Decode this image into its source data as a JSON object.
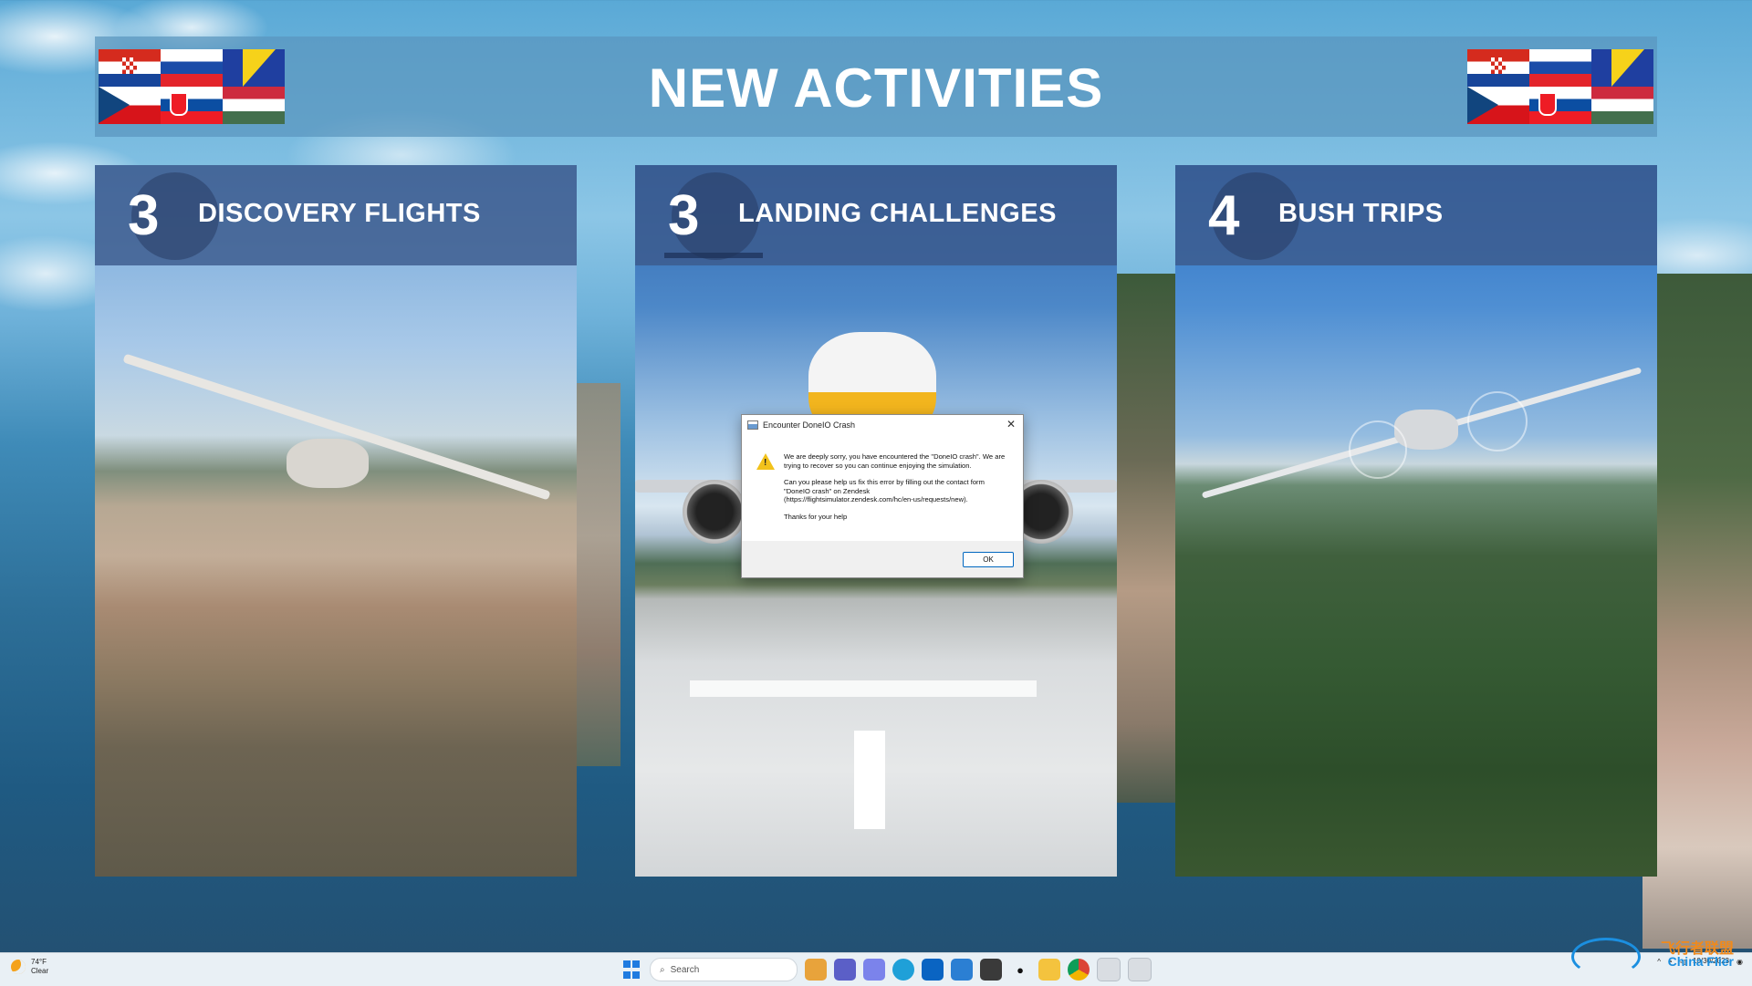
{
  "header": {
    "title": "NEW ACTIVITIES",
    "flags": [
      "croatia",
      "slovenia",
      "bosnia-herzegovina",
      "czechia",
      "slovakia",
      "hungary"
    ]
  },
  "cards": [
    {
      "number": "3",
      "title": "DISCOVERY FLIGHTS"
    },
    {
      "number": "3",
      "title": "LANDING CHALLENGES"
    },
    {
      "number": "4",
      "title": "BUSH TRIPS"
    }
  ],
  "dialog": {
    "title": "Encounter DoneIO Crash",
    "message_1": "We are deeply sorry, you have encountered the \"DoneIO crash\". We are trying to recover so you can continue enjoying the simulation.",
    "message_2": "Can you please help us fix this error by filling out the contact form \"DoneIO crash\" on Zendesk\n(https://flightsimulator.zendesk.com/hc/en-us/requests/new).",
    "message_3": "Thanks for your help",
    "ok_label": "OK",
    "close_glyph": "✕",
    "warning_glyph": "!"
  },
  "taskbar": {
    "weather_temp": "74°F",
    "weather_cond": "Clear",
    "search_placeholder": "Search",
    "clock_date": "10/30/2023",
    "icons": [
      "start-icon",
      "search-icon",
      "files-icon",
      "teams-icon",
      "chat-icon",
      "edge-icon",
      "outlook-icon",
      "store-icon",
      "photos-icon",
      "alienware-icon",
      "explorer-icon",
      "chrome-icon",
      "flightsim-icon",
      "app-icon"
    ]
  },
  "watermark": {
    "cn_text": "飞行者联盟",
    "en_text": "China Flier"
  },
  "colors": {
    "header_bg": "#5a96be",
    "card_head_bg": "#3c5a8c",
    "taskbar_bg": "#e9f0f5",
    "ok_border": "#0067c0",
    "warning": "#f2c21b"
  }
}
